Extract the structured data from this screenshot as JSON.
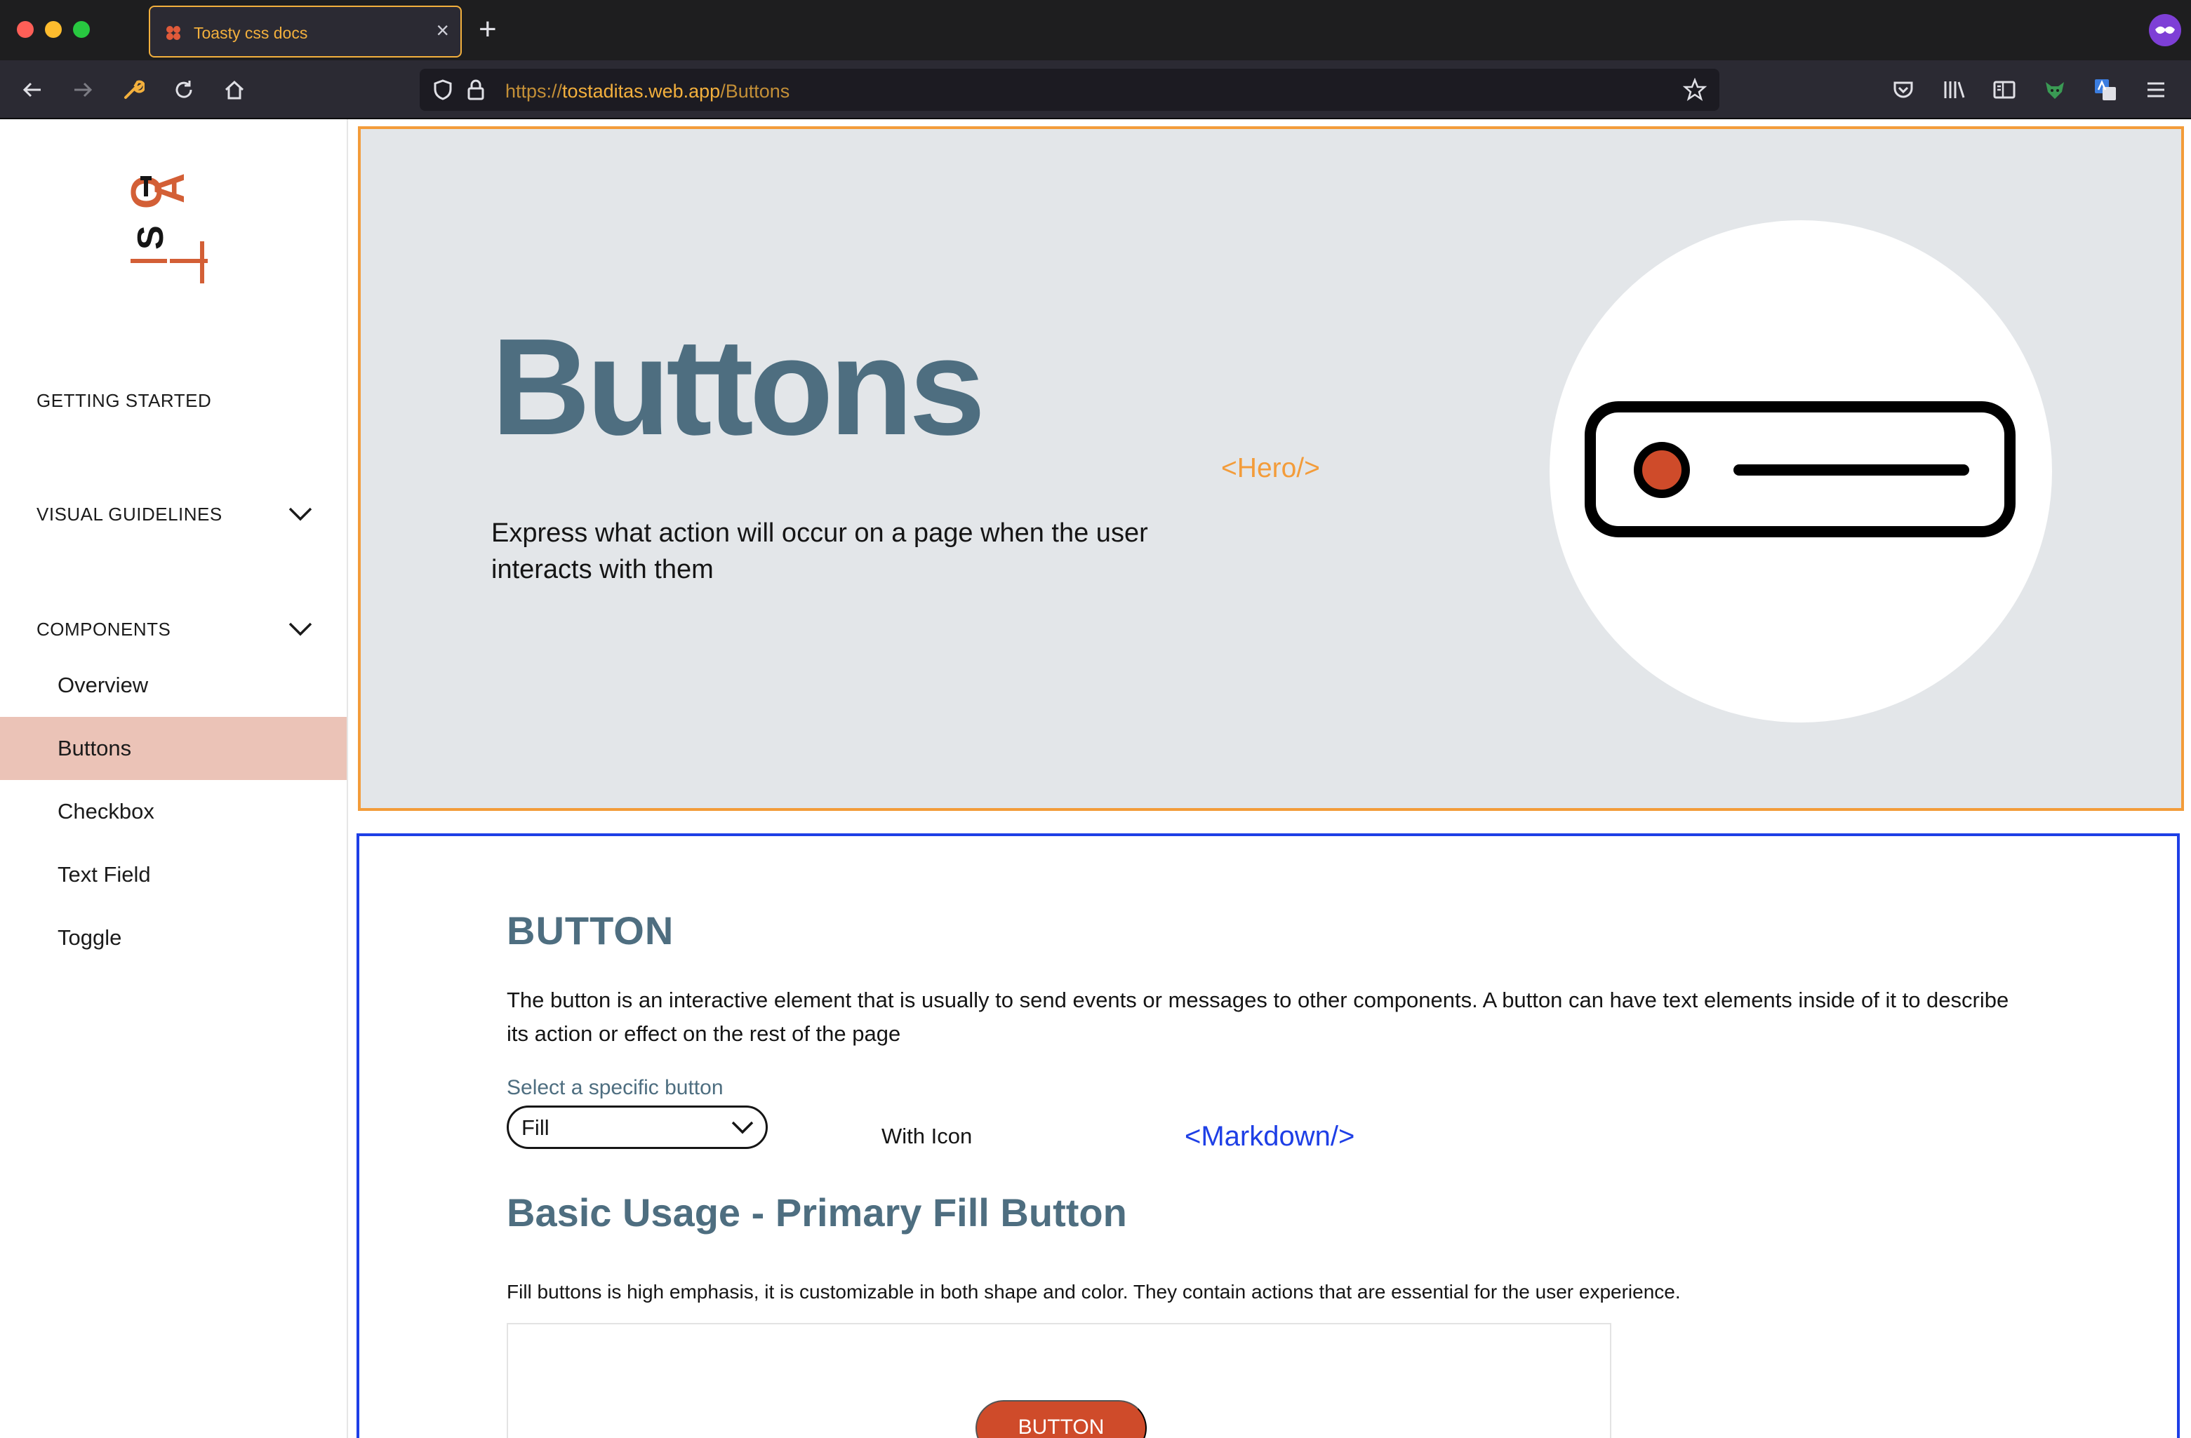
{
  "browser": {
    "tab_title": "Toasty css docs",
    "tab_close": "×",
    "new_tab": "+",
    "url": {
      "scheme": "https://",
      "host": "tostaditas.web.app",
      "path": "/Buttons"
    },
    "accent": "#f3b03d"
  },
  "sidebar": {
    "sections": [
      {
        "label": "GETTING STARTED",
        "expandable": false
      },
      {
        "label": "VISUAL GUIDELINES",
        "expandable": true
      },
      {
        "label": "COMPONENTS",
        "expandable": true
      }
    ],
    "items": [
      {
        "label": "Overview",
        "active": false
      },
      {
        "label": "Buttons",
        "active": true
      },
      {
        "label": "Checkbox",
        "active": false
      },
      {
        "label": "Text Field",
        "active": false
      },
      {
        "label": "Toggle",
        "active": false
      }
    ],
    "active_color": "#ebc3b7"
  },
  "hero": {
    "title": "Buttons",
    "subtitle": "Express what action will occur on a page when the user interacts with them",
    "tag": "<Hero/>",
    "border_color": "#f39c3a",
    "background": "#e3e6e9"
  },
  "markdown": {
    "heading": "BUTTON",
    "description": "The button is an interactive element that is usually to send events or messages to other components. A button can have text elements inside of it to describe its action or effect on the rest of the page",
    "select_label": "Select a specific button",
    "select_value": "Fill",
    "with_icon_label": "With Icon",
    "tag": "<Markdown/>",
    "usage_heading": "Basic Usage - Primary Fill Button",
    "usage_text": "Fill buttons is high emphasis, it is customizable in both shape and color. They contain actions that are essential for the user experience.",
    "demo_button_label": "BUTTON",
    "border_color": "#1e3fe6",
    "heading_color": "#4e6e80",
    "button_color": "#cf4b2a"
  }
}
